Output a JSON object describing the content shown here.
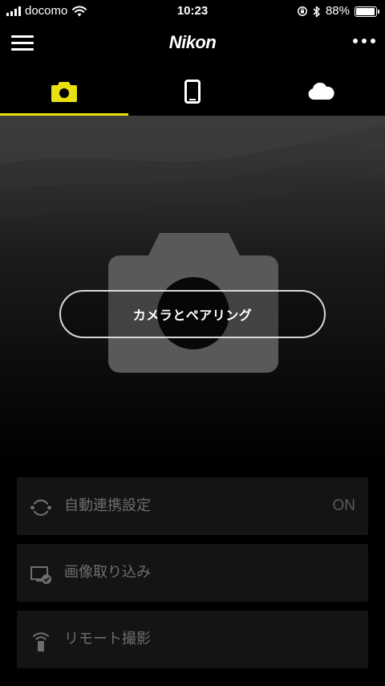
{
  "status_bar": {
    "carrier": "docomo",
    "time": "10:23",
    "battery_percent": "88%",
    "battery_level": 0.88
  },
  "header": {
    "brand": "Nikon",
    "menu_icon": "hamburger-menu-icon",
    "more_icon": "more-horizontal-icon"
  },
  "tabs": [
    {
      "icon": "camera-icon",
      "active": true
    },
    {
      "icon": "smartphone-icon",
      "active": false
    },
    {
      "icon": "cloud-icon",
      "active": false
    }
  ],
  "colors": {
    "accent": "#e9e00f",
    "background": "#000000",
    "card": "#141414",
    "muted_text": "#6e6e6e"
  },
  "hero": {
    "pair_label": "カメラとペアリング",
    "graphic_icon": "camera-silhouette"
  },
  "features": [
    {
      "label": "自動連携設定",
      "value": "ON",
      "icon": "auto-link-icon"
    },
    {
      "label": "画像取り込み",
      "value": "",
      "icon": "image-import-icon"
    },
    {
      "label": "リモート撮影",
      "value": "",
      "icon": "remote-shooting-icon"
    }
  ]
}
